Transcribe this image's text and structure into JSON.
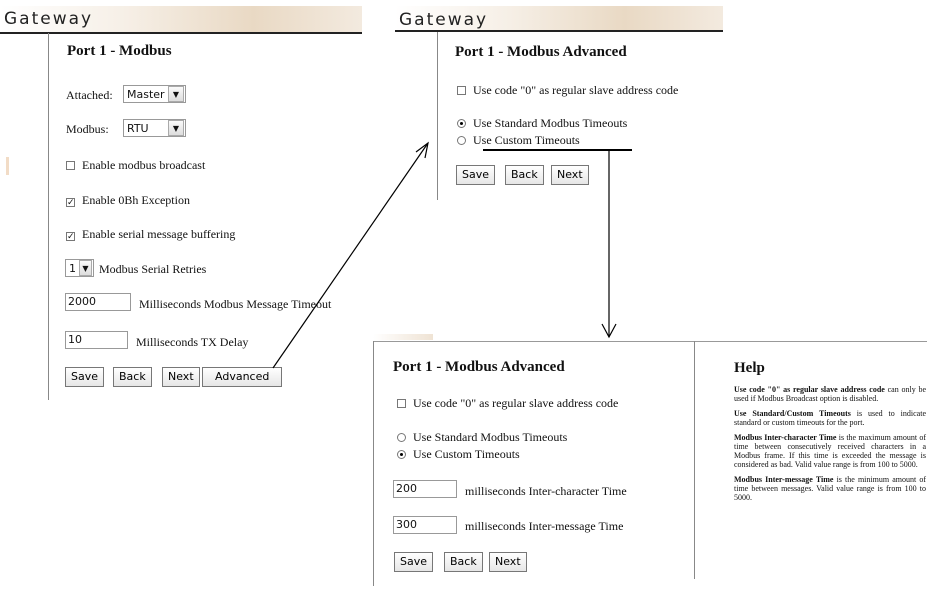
{
  "brand": "Gateway",
  "panel1": {
    "title": "Port 1 - Modbus",
    "attached_label": "Attached:",
    "attached_value": "Master",
    "modbus_label": "Modbus:",
    "modbus_value": "RTU",
    "broadcast_label": "Enable modbus broadcast",
    "exception_label": "Enable 0Bh Exception",
    "buffering_label": "Enable serial message buffering",
    "retries_value": "1",
    "retries_label": "Modbus Serial Retries",
    "timeout_value": "2000",
    "timeout_label": "Milliseconds Modbus Message Timeout",
    "txdelay_value": "10",
    "txdelay_label": "Milliseconds TX Delay",
    "buttons": {
      "save": "Save",
      "back": "Back",
      "next": "Next",
      "advanced": "Advanced"
    }
  },
  "panel2": {
    "title": "Port 1 - Modbus Advanced",
    "code0_label": "Use code \"0\" as regular slave address code",
    "standard_label": "Use Standard Modbus Timeouts",
    "custom_label": "Use Custom Timeouts",
    "buttons": {
      "save": "Save",
      "back": "Back",
      "next": "Next"
    }
  },
  "panel3": {
    "title": "Port 1 - Modbus Advanced",
    "code0_label": "Use code \"0\" as regular slave address code",
    "standard_label": "Use Standard Modbus Timeouts",
    "custom_label": "Use Custom Timeouts",
    "interchar_value": "200",
    "interchar_label": "milliseconds Inter-character Time",
    "intermsg_value": "300",
    "intermsg_label": "milliseconds Inter-message Time",
    "buttons": {
      "save": "Save",
      "back": "Back",
      "next": "Next"
    }
  },
  "help": {
    "title": "Help",
    "p1_bold": "Use code \"0\" as regular slave address code",
    "p1_text": " can only be used if Modbus Broadcast option is disabled.",
    "p2_bold": "Use Standard/Custom Timeouts",
    "p2_text": " is used to indicate standard or custom timeouts for the port.",
    "p3_bold": "Modbus Inter-character Time",
    "p3_text": " is the maximum amount of time between consecutively received characters in a Modbus frame. If this time is exceeded the message is considered as bad. Valid value range is from 100 to 5000.",
    "p4_bold": "Modbus Inter-message Time",
    "p4_text": " is the minimum amount of time between messages. Valid value range is from 100 to 5000."
  }
}
